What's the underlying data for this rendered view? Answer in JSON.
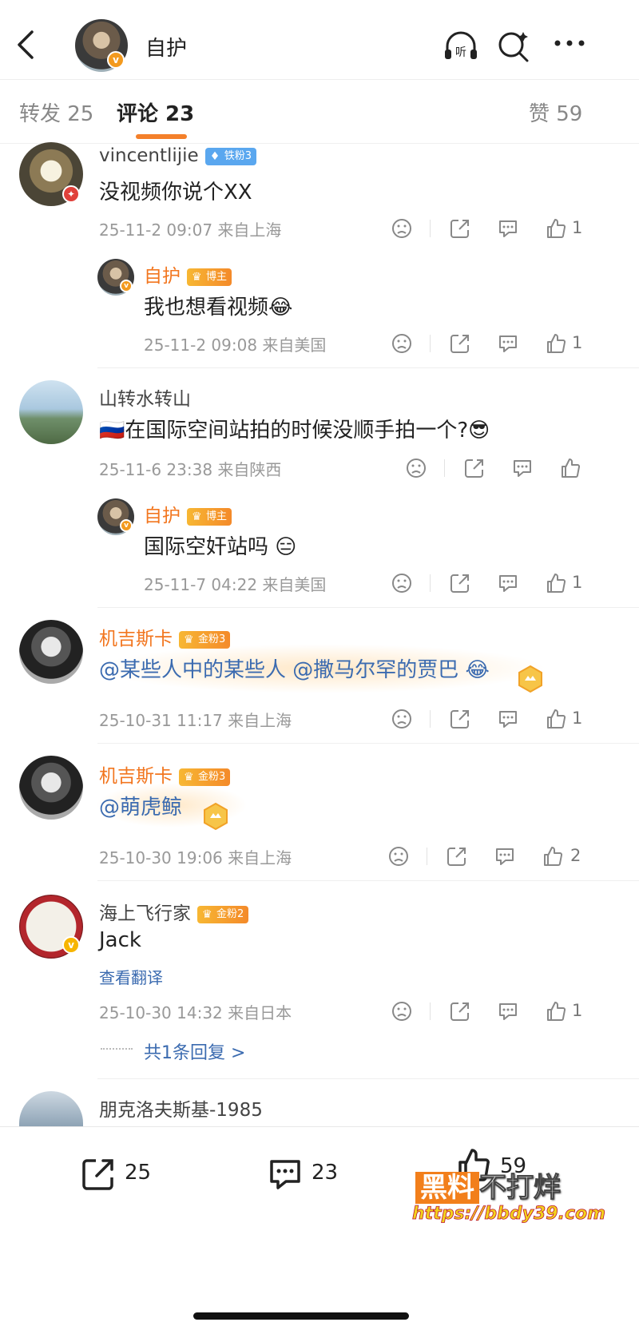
{
  "header": {
    "title": "自护",
    "icons": [
      "back-icon",
      "listen-icon",
      "search-icon",
      "more-icon"
    ],
    "listen_label": "听"
  },
  "tabs": [
    {
      "label": "转发 25"
    },
    {
      "label": "评论 23"
    },
    {
      "label": "赞 59"
    }
  ],
  "comments": [
    {
      "user": "vincentlijie",
      "badge": "铁粉3",
      "text": "没视频你说个XX",
      "meta": "25-11-2 09:07 来自上海",
      "likes": "1",
      "reply": {
        "user": "自护",
        "badge": "博主",
        "text": "我也想看视频😂",
        "meta": "25-11-2 09:08 来自美国",
        "likes": "1"
      }
    },
    {
      "user": "山转水转山",
      "text": "🇷🇺在国际空间站拍的时候没顺手拍一个?😎",
      "meta": "25-11-6 23:38 来自陕西",
      "reply": {
        "user": "自护",
        "badge": "博主",
        "text": "国际空奸站吗 😑",
        "meta": "25-11-7 04:22 来自美国",
        "likes": "1"
      }
    },
    {
      "user": "机吉斯卡",
      "badge": "金粉3",
      "text": "@某些人中的某些人 @撒马尔罕的贾巴 😂",
      "meta": "25-10-31 11:17 来自上海",
      "likes": "1"
    },
    {
      "user": "机吉斯卡",
      "badge": "金粉3",
      "text": "@萌虎鲸",
      "meta": "25-10-30 19:06 来自上海",
      "likes": "2"
    },
    {
      "user": "海上飞行家",
      "badge": "金粉2",
      "text": "Jack",
      "translate": "查看翻译",
      "meta": "25-10-30 14:32 来自日本",
      "likes": "1",
      "replies_link": "共1条回复 >"
    },
    {
      "user": "朋克洛夫斯基-1985"
    }
  ],
  "bottom_bar": {
    "repost_count": "25",
    "comment_count": "23",
    "like_count": "59"
  },
  "watermark": {
    "line1_box": "黑料",
    "line1_rest": "不打烊",
    "line2": "https://bbdy39.com"
  },
  "colors": {
    "accent": "#f4802a",
    "link": "#3b6bb0",
    "meta": "#999999"
  }
}
